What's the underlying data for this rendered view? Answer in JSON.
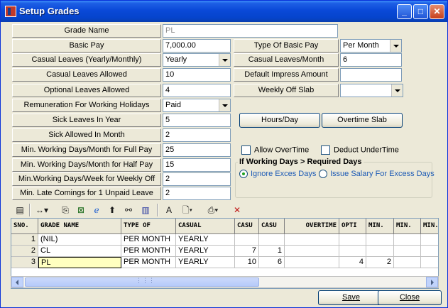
{
  "window": {
    "title": "Setup Grades",
    "minimize": "_",
    "maximize": "□",
    "close": "✕"
  },
  "form": {
    "grade_name": {
      "label": "Grade Name",
      "value": "PL"
    },
    "basic_pay": {
      "label": "Basic Pay",
      "value": "7,000.00"
    },
    "casual_leaves_type": {
      "label": "Casual Leaves (Yearly/Monthly)",
      "value": "Yearly"
    },
    "casual_leaves_allowed": {
      "label": "Casual Leaves Allowed",
      "value": "10"
    },
    "optional_leaves_allowed": {
      "label": "Optional Leaves Allowed",
      "value": "4"
    },
    "remuneration_holidays": {
      "label": "Remuneration For Working Holidays",
      "value": "Paid"
    },
    "sick_leaves_year": {
      "label": "Sick Leaves In Year",
      "value": "5"
    },
    "sick_allowed_month": {
      "label": "Sick Allowed In Month",
      "value": "2"
    },
    "min_days_full_pay": {
      "label": "Min. Working Days/Month  for Full Pay",
      "value": "25"
    },
    "min_days_half_pay": {
      "label": "Min. Working Days/Month  for Half Pay",
      "value": "15"
    },
    "min_days_weekly_off": {
      "label": "Min.Working Days/Week for Weekly Off",
      "value": "2"
    },
    "min_late_comings": {
      "label": "Min. Late Comings for 1 Unpaid Leave",
      "value": "2"
    },
    "type_basic_pay": {
      "label": "Type Of Basic Pay",
      "value": "Per Month"
    },
    "casual_leaves_month": {
      "label": "Casual Leaves/Month",
      "value": "6"
    },
    "default_impress": {
      "label": "Default Impress Amount",
      "value": ""
    },
    "weekly_off_slab": {
      "label": "Weekly Off Slab",
      "value": ""
    },
    "hours_day_button": "Hours/Day",
    "overtime_slab_button": "Overtime Slab",
    "allow_overtime": "Allow OverTime",
    "deduct_undertime": "Deduct UnderTime",
    "working_days_group": "If Working Days > Required Days",
    "ignore_excess": "Ignore Exces Days",
    "issue_salary": "Issue Salary For Excess Days"
  },
  "grid": {
    "headers": [
      "SNO.",
      "GRADE NAME",
      "TYPE OF",
      "CASUAL",
      "CASU",
      "CASU",
      "OVERTIME",
      "OPTI",
      "MIN.",
      "MIN.",
      "MIN."
    ],
    "rows": [
      {
        "sno": "1",
        "grade": "(NIL)",
        "type": "PER MONTH",
        "casual": "YEARLY",
        "c1": "",
        "c2": "",
        "ot": "",
        "opti": "",
        "min1": "",
        "min2": "",
        "min3": ""
      },
      {
        "sno": "2",
        "grade": "CL",
        "type": "PER MONTH",
        "casual": "YEARLY",
        "c1": "7",
        "c2": "1",
        "ot": "",
        "opti": "",
        "min1": "",
        "min2": "",
        "min3": ""
      },
      {
        "sno": "3",
        "grade": "PL",
        "type": "PER MONTH",
        "casual": "YEARLY",
        "c1": "10",
        "c2": "6",
        "ot": "",
        "opti": "4",
        "min1": "2",
        "min2": "",
        "min3": ""
      }
    ]
  },
  "footer": {
    "save": "Save",
    "close": "Close"
  },
  "scrollbar": {
    "thumb_glyph": "⋮⋮⋮"
  }
}
